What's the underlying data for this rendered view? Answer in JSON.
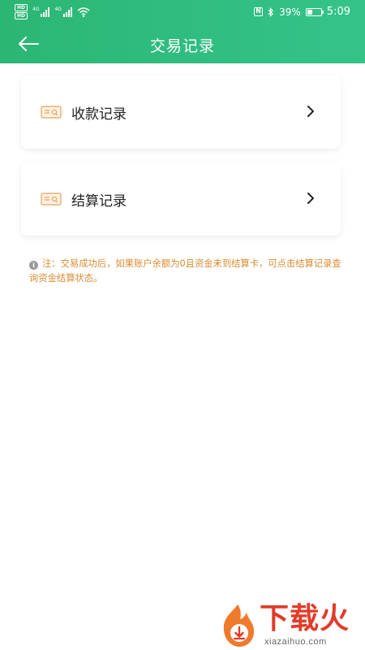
{
  "status_bar": {
    "hd1": "HD",
    "hd2": "HD",
    "net1": "4G",
    "net2": "4G",
    "battery_percent": "39%",
    "battery_level": 0.39,
    "time": "5:09",
    "icons": [
      "signal-icon",
      "wifi-icon",
      "nfc-icon",
      "bluetooth-icon",
      "battery-icon"
    ]
  },
  "header": {
    "title": "交易记录",
    "back_icon": "arrow-left-icon",
    "bg_color": "#2bb673"
  },
  "cards": [
    {
      "label": "收款记录",
      "icon": "card-icon",
      "chevron": "chevron-right-icon"
    },
    {
      "label": "结算记录",
      "icon": "card-icon",
      "chevron": "chevron-right-icon"
    }
  ],
  "note": {
    "icon": "info-icon",
    "text": "注：交易成功后，如果账户余额为0且资金未到结算卡，可点击结算记录查询资金结算状态。",
    "color": "#d98b30"
  },
  "watermark": {
    "name": "下载火",
    "url": "xiazaihuo.com"
  }
}
